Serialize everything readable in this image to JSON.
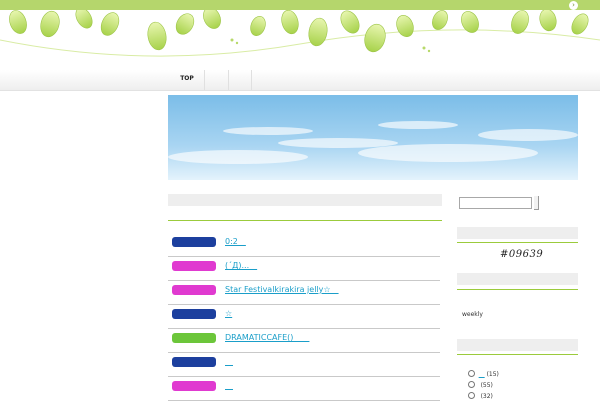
{
  "nav": {
    "items": [
      "TOP",
      "",
      ""
    ]
  },
  "entries": [
    {
      "title": "0:2　",
      "tag_color": "#1c3f9e"
    },
    {
      "title": "(´Д)...　",
      "tag_color": "#e03ad0"
    },
    {
      "title": "Star Festivalkirakira jelly☆　",
      "tag_color": "#e03ad0"
    },
    {
      "title": "☆",
      "tag_color": "#1c3f9e"
    },
    {
      "title": "DRAMATICCAFE()　　",
      "tag_color": "#6cc63a"
    },
    {
      "title": "　",
      "tag_color": "#1c3f9e"
    },
    {
      "title": "　",
      "tag_color": "#e03ad0"
    }
  ],
  "sidebar": {
    "counter": "#09639",
    "weekly_label": "weekly",
    "categories": [
      {
        "name": "　",
        "count": "(15)"
      },
      {
        "name": "",
        "count": "(55)"
      },
      {
        "name": "",
        "count": "(32)"
      }
    ]
  },
  "colors": {
    "top_bar": "#b5d66c",
    "accent_rule": "#9bcb3c",
    "link": "#1a9ec9"
  }
}
